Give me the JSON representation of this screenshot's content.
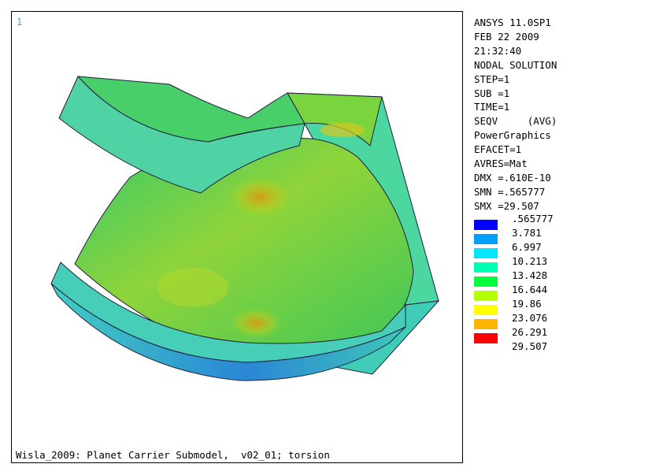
{
  "viewport": {
    "window_number": "1",
    "caption": "Wisla_2009: Planet Carrier Submodel,  v02_01; torsion"
  },
  "info": {
    "lines": [
      "ANSYS 11.0SP1",
      "FEB 22 2009",
      "21:32:40",
      "NODAL SOLUTION",
      "STEP=1",
      "SUB =1",
      "TIME=1",
      "SEQV     (AVG)",
      "PowerGraphics",
      "EFACET=1",
      "AVRES=Mat",
      "DMX =.610E-10",
      "SMN =.565777",
      "SMX =29.507"
    ]
  },
  "legend": {
    "labels": [
      ".565777",
      "3.781",
      "6.997",
      "10.213",
      "13.428",
      "16.644",
      "19.86",
      "23.076",
      "26.291",
      "29.507"
    ],
    "colors": [
      "#0000ff",
      "#00a0ff",
      "#00e6ff",
      "#00ffb4",
      "#00ff3c",
      "#b4ff00",
      "#ffff00",
      "#ffb400",
      "#ff0000"
    ]
  },
  "model_colors": {
    "outline": "#1a1a40",
    "cyan_face": "#4fd6c8",
    "green_face": "#3fce5a",
    "blue_band": "#2f7fd8",
    "hot_spot": "#d8a418"
  }
}
